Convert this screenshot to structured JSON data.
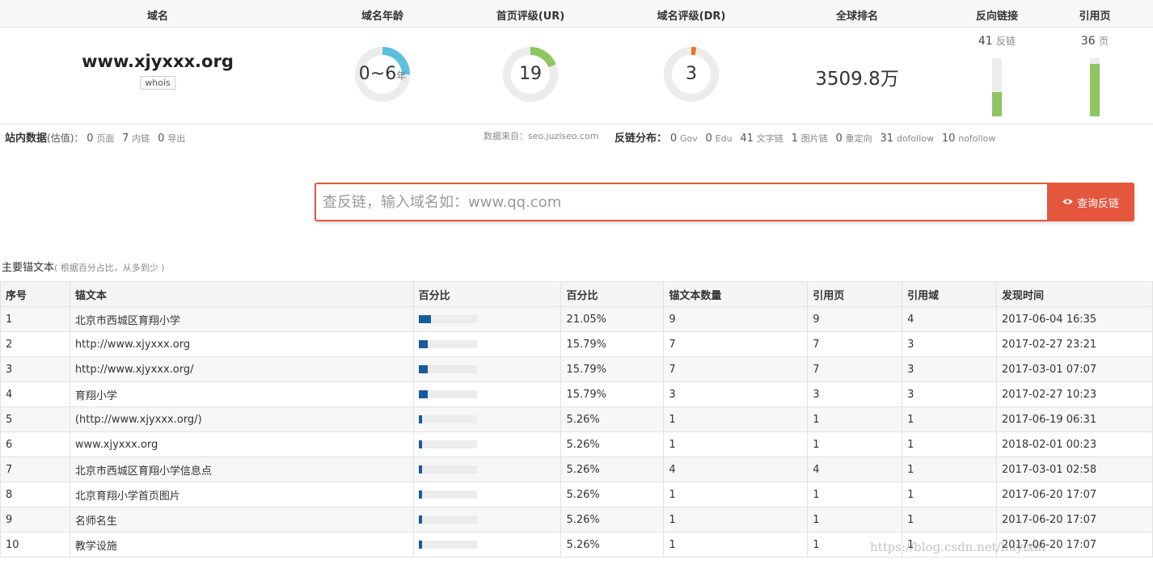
{
  "header": {
    "cols": [
      "域名",
      "域名年龄",
      "首页评级(UR)",
      "域名评级(DR)",
      "全球排名",
      "反向链接",
      "引用页"
    ]
  },
  "domain": {
    "name": "www.xjyxxx.org",
    "whois_label": "whois"
  },
  "metrics": {
    "age": {
      "value": "0~6",
      "unit": "年",
      "fraction": 0.25,
      "color": "#5bc0de"
    },
    "ur": {
      "value": "19",
      "fraction": 0.19,
      "color": "#8dc663"
    },
    "dr": {
      "value": "3",
      "fraction": 0.03,
      "color": "#f0741f"
    },
    "rank": "3509.8万",
    "backlinks": {
      "value": "41",
      "unit": "反链",
      "fraction": 0.41
    },
    "ref_pages": {
      "value": "36",
      "unit": "页",
      "fraction": 0.9
    }
  },
  "site_stats": {
    "label": "站内数据",
    "hint": "(估值)：",
    "pages": "0",
    "pages_unit": "页面",
    "internal": "7",
    "internal_unit": "内链",
    "external": "0",
    "external_unit": "导出"
  },
  "source": "数据来自：seo.juziseo.com",
  "backlink_dist": {
    "label": "反链分布：",
    "items": [
      {
        "n": "0",
        "u": "Gov"
      },
      {
        "n": "0",
        "u": "Edu"
      },
      {
        "n": "41",
        "u": "文字链"
      },
      {
        "n": "1",
        "u": "图片链"
      },
      {
        "n": "0",
        "u": "重定向"
      },
      {
        "n": "31",
        "u": "dofollow"
      },
      {
        "n": "10",
        "u": "nofollow"
      }
    ]
  },
  "search": {
    "placeholder": "查反链，输入域名如：www.qq.com",
    "button_label": "查询反链",
    "button_icon": "eye-icon"
  },
  "anchors": {
    "title": "主要锚文本",
    "hint": "( 根据百分占比，从多到少 )",
    "columns": [
      "序号",
      "锚文本",
      "百分比",
      "百分比",
      "锚文本数量",
      "引用页",
      "引用域",
      "发现时间"
    ],
    "rows": [
      {
        "idx": "1",
        "text": "北京市西城区育翔小学",
        "pct": 21.05,
        "pct_label": "21.05%",
        "count": "9",
        "pages": "9",
        "domains": "4",
        "time": "2017-06-04 16:35"
      },
      {
        "idx": "2",
        "text": "http://www.xjyxxx.org",
        "pct": 15.79,
        "pct_label": "15.79%",
        "count": "7",
        "pages": "7",
        "domains": "3",
        "time": "2017-02-27 23:21"
      },
      {
        "idx": "3",
        "text": "http://www.xjyxxx.org/",
        "pct": 15.79,
        "pct_label": "15.79%",
        "count": "7",
        "pages": "7",
        "domains": "3",
        "time": "2017-03-01 07:07"
      },
      {
        "idx": "4",
        "text": "育翔小学",
        "pct": 15.79,
        "pct_label": "15.79%",
        "count": "3",
        "pages": "3",
        "domains": "3",
        "time": "2017-02-27 10:23"
      },
      {
        "idx": "5",
        "text": "(http://www.xjyxxx.org/)",
        "pct": 5.26,
        "pct_label": "5.26%",
        "count": "1",
        "pages": "1",
        "domains": "1",
        "time": "2017-06-19 06:31"
      },
      {
        "idx": "6",
        "text": "www.xjyxxx.org",
        "pct": 5.26,
        "pct_label": "5.26%",
        "count": "1",
        "pages": "1",
        "domains": "1",
        "time": "2018-02-01 00:23"
      },
      {
        "idx": "7",
        "text": "北京市西城区育翔小学信息点",
        "pct": 5.26,
        "pct_label": "5.26%",
        "count": "4",
        "pages": "4",
        "domains": "1",
        "time": "2017-03-01 02:58"
      },
      {
        "idx": "8",
        "text": "北京育翔小学首页图片",
        "pct": 5.26,
        "pct_label": "5.26%",
        "count": "1",
        "pages": "1",
        "domains": "1",
        "time": "2017-06-20 17:07"
      },
      {
        "idx": "9",
        "text": "名师名生",
        "pct": 5.26,
        "pct_label": "5.26%",
        "count": "1",
        "pages": "1",
        "domains": "1",
        "time": "2017-06-20 17:07"
      },
      {
        "idx": "10",
        "text": "教学设施",
        "pct": 5.26,
        "pct_label": "5.26%",
        "count": "1",
        "pages": "1",
        "domains": "1",
        "time": "2017-06-20 17:07"
      }
    ]
  },
  "watermark": "https://blog.csdn.net/liuyixin"
}
